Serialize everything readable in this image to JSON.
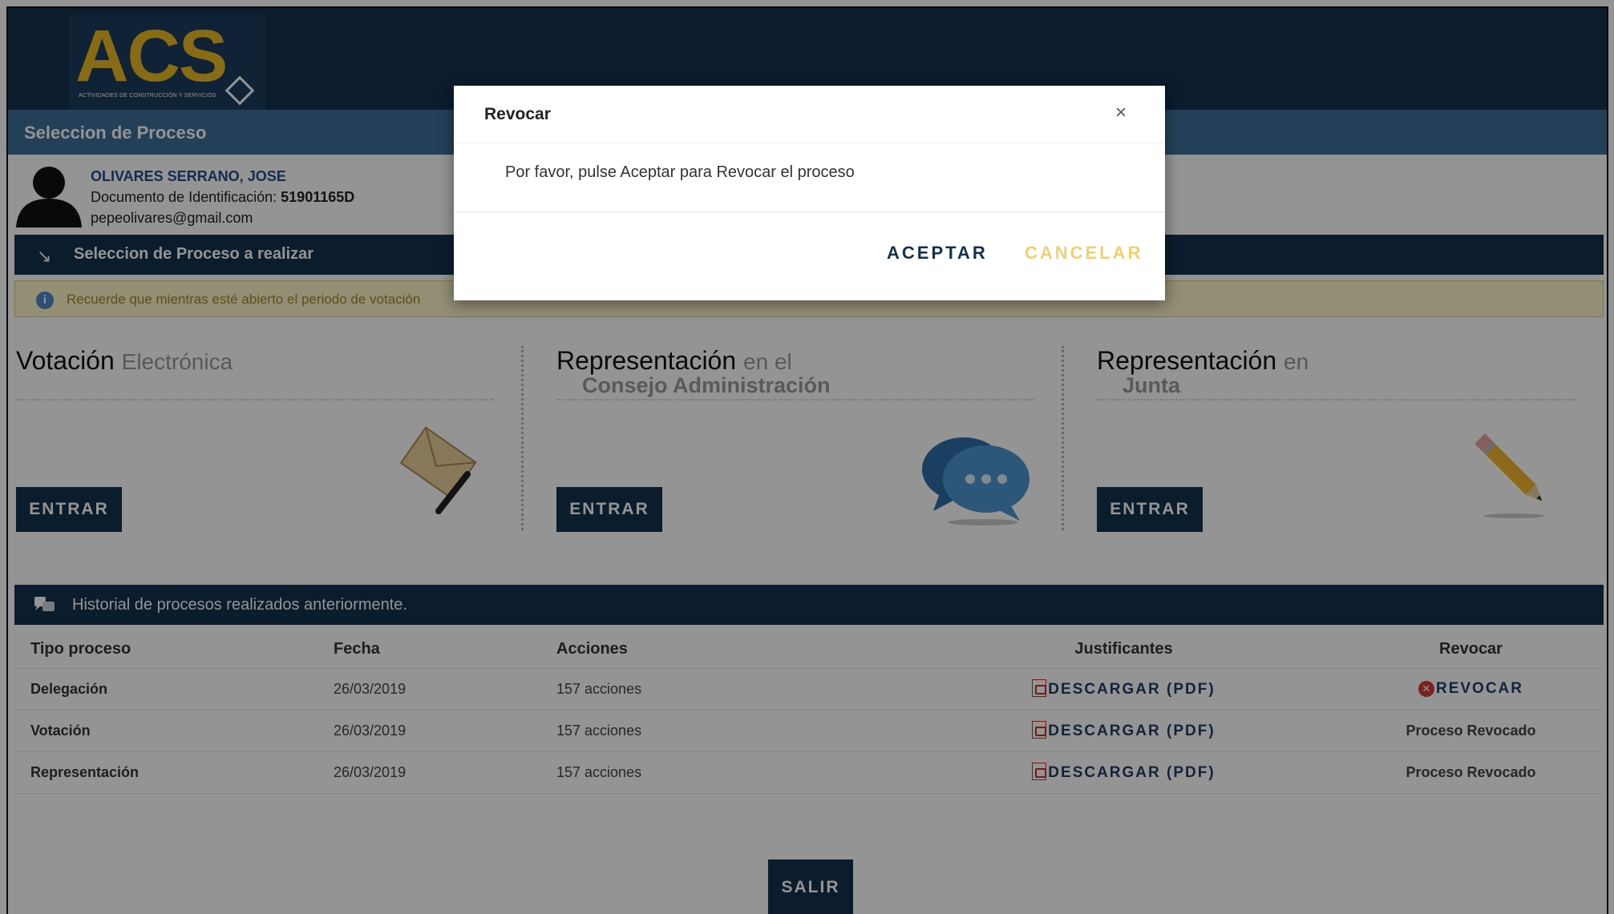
{
  "header": {
    "logo_text": "ACS",
    "logo_subtitle": "ACTIVIDADES DE CONSTRUCCIÓN Y SERVICIOS",
    "section_title": "Seleccion de Proceso"
  },
  "user": {
    "name": "OLIVARES SERRANO, JOSE",
    "doc_label": "Documento de Identificación:",
    "doc_number": "51901165D",
    "email": "pepeolivares@gmail.com"
  },
  "process_bar": {
    "title": "Seleccion de Proceso a realizar"
  },
  "notice": {
    "text": "Recuerde que mientras esté abierto el periodo de votación"
  },
  "columns": [
    {
      "title": "Votación",
      "subtitle_inline": "Electrónica",
      "subtitle_line2": "",
      "button": "ENTRAR",
      "icon": "envelope-icon"
    },
    {
      "title": "Representación",
      "subtitle_inline": "en el",
      "subtitle_line2": "Consejo Administración",
      "button": "ENTRAR",
      "icon": "chat-bubbles-icon"
    },
    {
      "title": "Representación",
      "subtitle_inline": "en",
      "subtitle_line2": "Junta",
      "button": "ENTRAR",
      "icon": "pencil-icon"
    }
  ],
  "history": {
    "title": "Historial de procesos realizados anteriormente.",
    "headers": [
      "Tipo proceso",
      "Fecha",
      "Acciones",
      "Justificantes",
      "Revocar"
    ],
    "rows": [
      {
        "type": "Delegación",
        "date": "26/03/2019",
        "actions": "157 acciones",
        "download": "DESCARGAR (PDF)",
        "revoke": "REVOCAR",
        "revoke_link": true
      },
      {
        "type": "Votación",
        "date": "26/03/2019",
        "actions": "157 acciones",
        "download": "DESCARGAR (PDF)",
        "revoke": "Proceso Revocado",
        "revoke_link": false
      },
      {
        "type": "Representación",
        "date": "26/03/2019",
        "actions": "157 acciones",
        "download": "DESCARGAR (PDF)",
        "revoke": "Proceso Revocado",
        "revoke_link": false
      }
    ]
  },
  "exit_button": "SALIR",
  "modal": {
    "title": "Revocar",
    "close": "×",
    "message": "Por favor, pulse Aceptar para Revocar el proceso",
    "accept": "ACEPTAR",
    "cancel": "CANCELAR"
  },
  "colors": {
    "navy": "#13314f",
    "section_blue": "#3f6f98",
    "logo_gold": "#e8b825",
    "cancel_yellow": "#f1d073",
    "notice_bg": "#fdf4c9"
  }
}
